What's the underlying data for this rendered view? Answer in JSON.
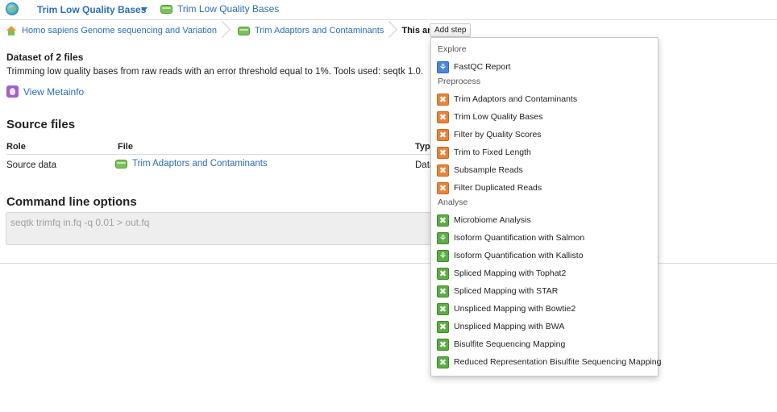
{
  "topbar": {
    "analysis_title": "Trim Low Quality Bases",
    "dataset_link": "Trim Low Quality Bases"
  },
  "breadcrumb": {
    "items": [
      {
        "label": "Homo sapiens Genome sequencing and Variation",
        "icon": "home-icon"
      },
      {
        "label": "Trim Adaptors and Contaminants",
        "icon": "dataset-icon"
      },
      {
        "label": "This analysis",
        "icon": ""
      }
    ],
    "add_step_label": "Add step"
  },
  "dataset": {
    "title": "Dataset of 2 files",
    "description": "Trimming low quality bases from raw reads with an error threshold equal to 1%. Tools used: seqtk 1.0.",
    "metainfo_label": "View Metainfo"
  },
  "source_files": {
    "heading": "Source files",
    "columns": [
      "Role",
      "File",
      "Type"
    ],
    "rows": [
      {
        "role": "Source data",
        "file": "Trim Adaptors and Contaminants",
        "type": "Data"
      }
    ]
  },
  "command_line": {
    "heading": "Command line options",
    "value": "seqtk trimfq in.fq -q 0.01 > out.fq"
  },
  "dropdown": {
    "sections": [
      {
        "label": "Explore",
        "items": [
          {
            "label": "FastQC Report",
            "color": "#4a86d8",
            "icon": "microscope-icon"
          }
        ]
      },
      {
        "label": "Preprocess",
        "items": [
          {
            "label": "Trim Adaptors and Contaminants",
            "color": "#e8833a",
            "icon": "tools-icon"
          },
          {
            "label": "Trim Low Quality Bases",
            "color": "#e8833a",
            "icon": "tools-icon"
          },
          {
            "label": "Filter by Quality Scores",
            "color": "#e8833a",
            "icon": "tools-icon"
          },
          {
            "label": "Trim to Fixed Length",
            "color": "#e8833a",
            "icon": "tools-icon"
          },
          {
            "label": "Subsample Reads",
            "color": "#e8833a",
            "icon": "tools-icon"
          },
          {
            "label": "Filter Duplicated Reads",
            "color": "#e8833a",
            "icon": "tools-icon"
          }
        ]
      },
      {
        "label": "Analyse",
        "items": [
          {
            "label": "Microbiome Analysis",
            "color": "#5aae43",
            "icon": "tools-icon"
          },
          {
            "label": "Isoform Quantification with Salmon",
            "color": "#5aae43",
            "icon": "microscope-icon"
          },
          {
            "label": "Isoform Quantification with Kallisto",
            "color": "#5aae43",
            "icon": "microscope-icon"
          },
          {
            "label": "Spliced Mapping with Tophat2",
            "color": "#5aae43",
            "icon": "tools-icon"
          },
          {
            "label": "Spliced Mapping with STAR",
            "color": "#5aae43",
            "icon": "tools-icon"
          },
          {
            "label": "Unspliced Mapping with Bowtie2",
            "color": "#5aae43",
            "icon": "tools-icon"
          },
          {
            "label": "Unspliced Mapping with BWA",
            "color": "#5aae43",
            "icon": "tools-icon"
          },
          {
            "label": "Bisulfite Sequencing Mapping",
            "color": "#5aae43",
            "icon": "tools-icon"
          },
          {
            "label": "Reduced Representation Bisulfite Sequencing Mapping",
            "color": "#5aae43",
            "icon": "tools-icon"
          }
        ]
      }
    ]
  }
}
